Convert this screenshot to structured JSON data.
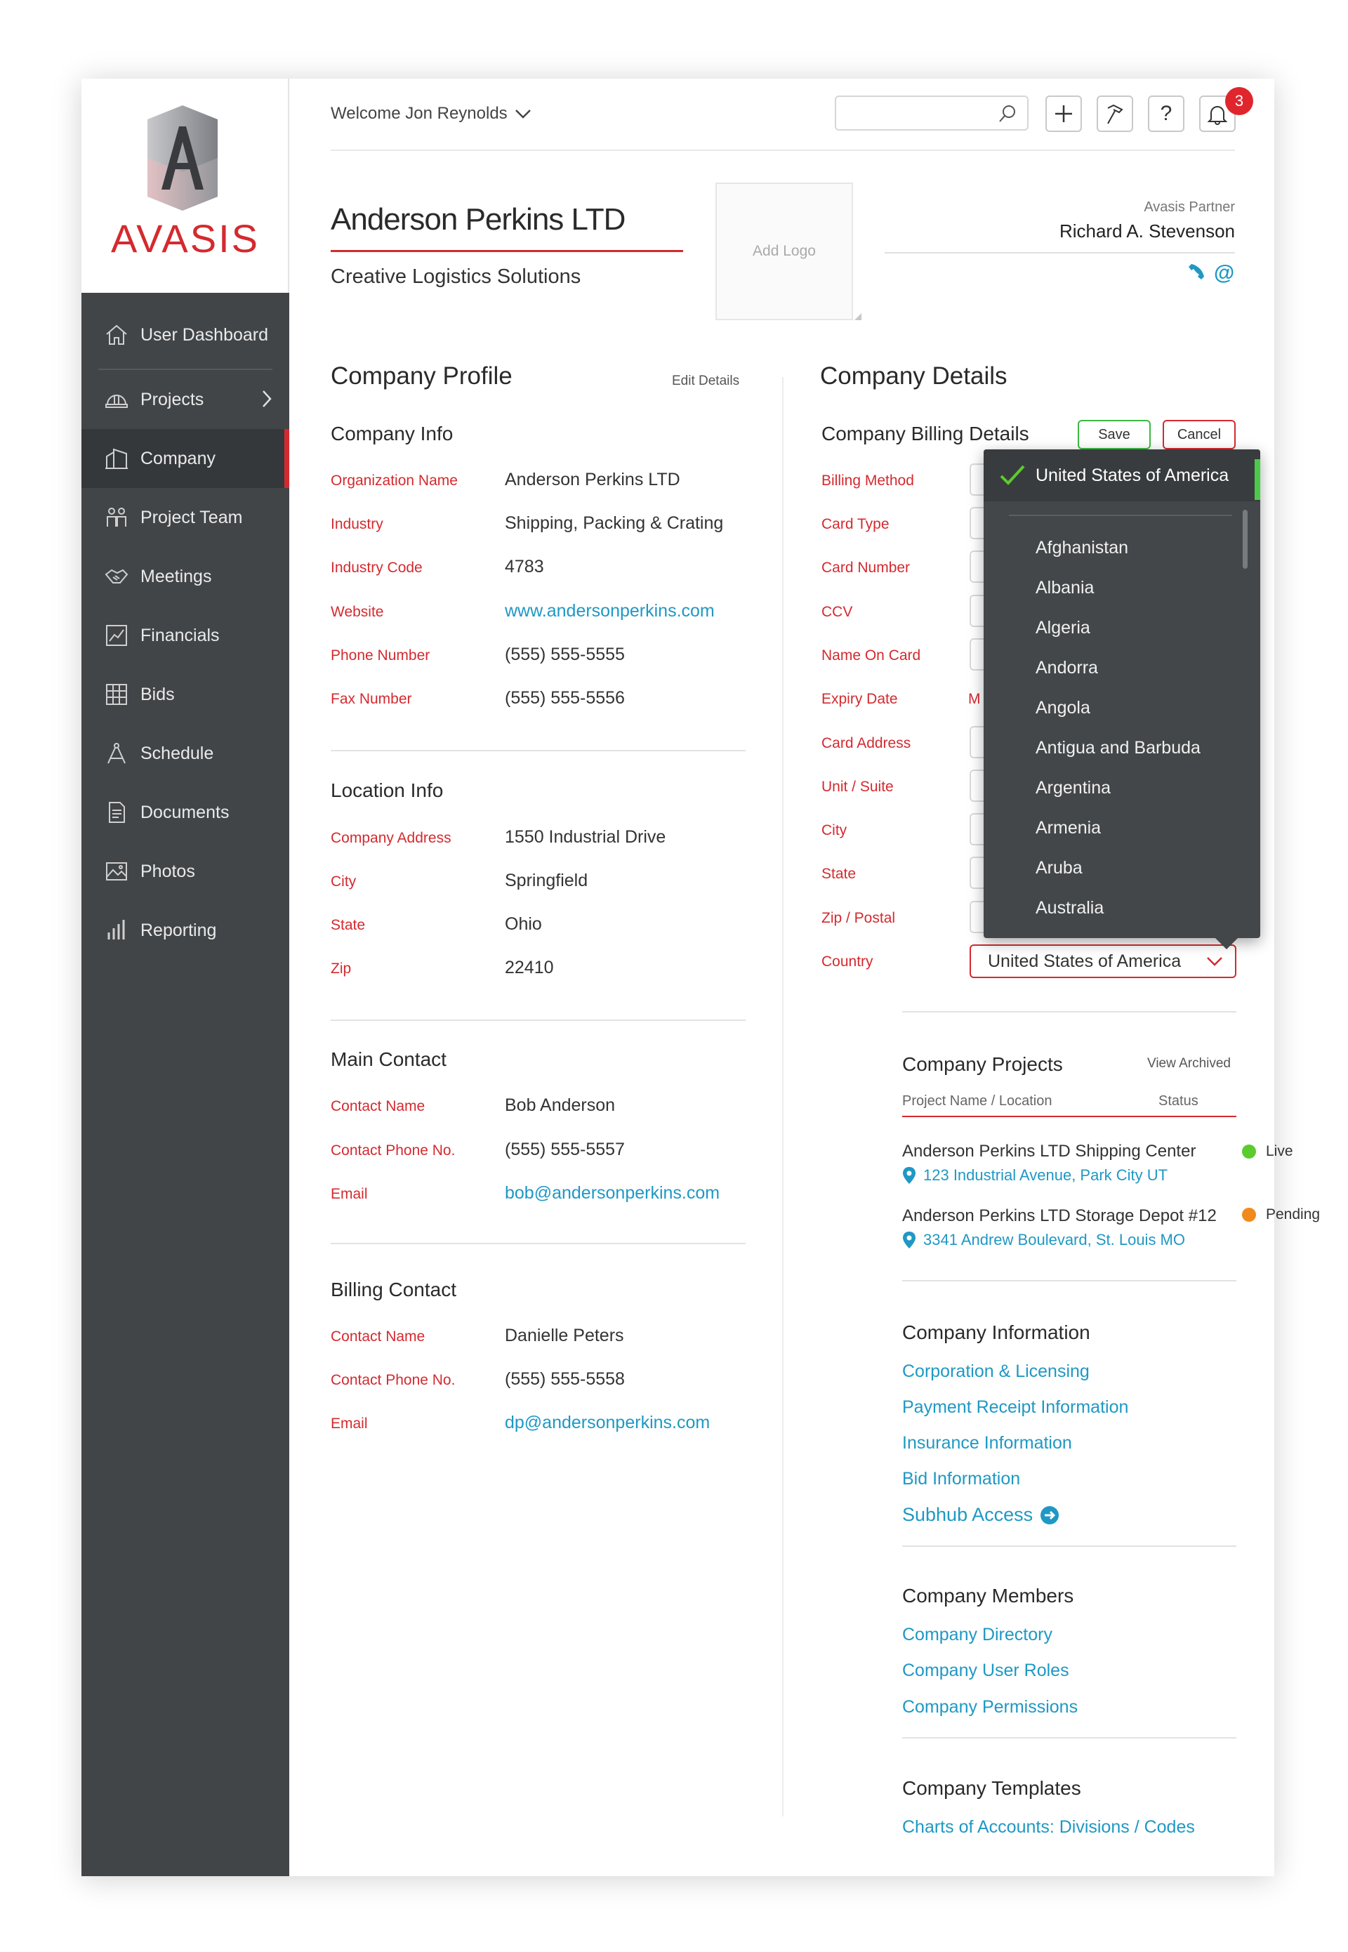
{
  "brand": {
    "name": "AVASIS",
    "accent": "#d42a2f",
    "link_color": "#1f98c4",
    "sidebar_bg": "#424548"
  },
  "sidebar": {
    "items": [
      {
        "label": "User Dashboard",
        "icon": "home-icon"
      },
      {
        "label": "Projects",
        "icon": "hardhat-icon"
      },
      {
        "label": "Company",
        "icon": "building-icon"
      },
      {
        "label": "Project Team",
        "icon": "team-icon"
      },
      {
        "label": "Meetings",
        "icon": "handshake-icon"
      },
      {
        "label": "Financials",
        "icon": "chart-icon"
      },
      {
        "label": "Bids",
        "icon": "grid-icon"
      },
      {
        "label": "Schedule",
        "icon": "compass-icon"
      },
      {
        "label": "Documents",
        "icon": "document-icon"
      },
      {
        "label": "Photos",
        "icon": "image-icon"
      },
      {
        "label": "Reporting",
        "icon": "bars-icon"
      }
    ]
  },
  "header": {
    "welcome": "Welcome Jon Reynolds",
    "search_placeholder": "",
    "notification_count": "3"
  },
  "company": {
    "name": "Anderson Perkins LTD",
    "tagline": "Creative Logistics Solutions",
    "add_logo": "Add Logo",
    "partner_label": "Avasis Partner",
    "partner_name": "Richard A. Stevenson"
  },
  "profile": {
    "title": "Company Profile",
    "edit": "Edit Details",
    "company_info": {
      "title": "Company Info",
      "rows": [
        {
          "label": "Organization Name",
          "value": "Anderson Perkins LTD"
        },
        {
          "label": "Industry",
          "value": "Shipping, Packing & Crating"
        },
        {
          "label": "Industry Code",
          "value": "4783"
        },
        {
          "label": "Website",
          "value": "www.andersonperkins.com"
        },
        {
          "label": "Phone Number",
          "value": "(555) 555-5555"
        },
        {
          "label": "Fax Number",
          "value": "(555) 555-5556"
        }
      ]
    },
    "location_info": {
      "title": "Location Info",
      "rows": [
        {
          "label": "Company Address",
          "value": "1550 Industrial Drive"
        },
        {
          "label": "City",
          "value": "Springfield"
        },
        {
          "label": "State",
          "value": "Ohio"
        },
        {
          "label": "Zip",
          "value": "22410"
        }
      ]
    },
    "main_contact": {
      "title": "Main Contact",
      "rows": [
        {
          "label": "Contact Name",
          "value": "Bob Anderson"
        },
        {
          "label": "Contact Phone No.",
          "value": "(555) 555-5557"
        },
        {
          "label": "Email",
          "value": "bob@andersonperkins.com"
        }
      ]
    },
    "billing_contact": {
      "title": "Billing Contact",
      "rows": [
        {
          "label": "Contact Name",
          "value": "Danielle Peters"
        },
        {
          "label": "Contact Phone No.",
          "value": "(555) 555-5558"
        },
        {
          "label": "Email",
          "value": "dp@andersonperkins.com"
        }
      ]
    }
  },
  "details": {
    "title": "Company Details",
    "billing": {
      "title": "Company Billing Details",
      "save": "Save",
      "cancel": "Cancel",
      "labels": [
        "Billing Method",
        "Card Type",
        "Card Number",
        "CCV",
        "Name On Card",
        "Expiry Date",
        "Card Address",
        "Unit / Suite",
        "City",
        "State",
        "Zip / Postal",
        "Country"
      ],
      "expiry_fragment": "M",
      "country_value": "United States of America"
    },
    "country_dropdown": {
      "selected": "United States of America",
      "options": [
        "Afghanistan",
        "Albania",
        "Algeria",
        "Andorra",
        "Angola",
        "Antigua and Barbuda",
        "Argentina",
        "Armenia",
        "Aruba",
        "Australia"
      ]
    },
    "projects": {
      "title": "Company Projects",
      "view_archived": "View Archived",
      "col_name": "Project Name / Location",
      "col_status": "Status",
      "items": [
        {
          "name": "Anderson Perkins LTD Shipping Center",
          "location": "123 Industrial Avenue, Park City UT",
          "status": "Live",
          "status_color": "#5ccb2e"
        },
        {
          "name": "Anderson Perkins LTD Storage Depot #12",
          "location": "3341 Andrew Boulevard, St. Louis MO",
          "status": "Pending",
          "status_color": "#f08a1c"
        }
      ]
    },
    "information": {
      "title": "Company Information",
      "links": [
        "Corporation & Licensing",
        "Payment Receipt Information",
        "Insurance Information",
        "Bid Information"
      ],
      "subhub": "Subhub Access"
    },
    "members": {
      "title": "Company Members",
      "links": [
        "Company Directory",
        "Company User Roles",
        "Company Permissions"
      ]
    },
    "templates": {
      "title": "Company Templates",
      "links": [
        "Charts of Accounts: Divisions / Codes"
      ]
    }
  }
}
